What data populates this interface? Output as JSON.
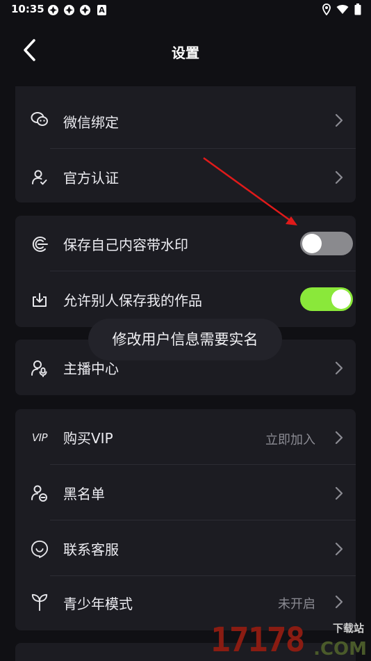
{
  "status": {
    "time": "10:35",
    "a_badge": "A"
  },
  "header": {
    "title": "设置"
  },
  "card1": {
    "items": [
      {
        "label": "微信绑定"
      },
      {
        "label": "官方认证"
      }
    ]
  },
  "card2": {
    "items": [
      {
        "label": "保存自己内容带水印",
        "toggle_on": false
      },
      {
        "label": "允许别人保存我的作品",
        "toggle_on": true
      }
    ]
  },
  "toast": "修改用户信息需要实名",
  "card3": {
    "items": [
      {
        "label": "主播中心"
      }
    ]
  },
  "card4": {
    "items": [
      {
        "label": "购买VIP",
        "value": "立即加入",
        "icon_text": "VIP"
      },
      {
        "label": "黑名单"
      },
      {
        "label": "联系客服"
      },
      {
        "label": "青少年模式",
        "value": "未开启"
      }
    ]
  },
  "watermark": {
    "digits": "17178",
    "com": ".COM",
    "cn": "下载站"
  },
  "colors": {
    "background": "#101014",
    "card": "#1c1c22",
    "toggle_on": "#8ae83a",
    "toggle_off": "#8a8a8e",
    "arrow": "#e01a1a"
  }
}
